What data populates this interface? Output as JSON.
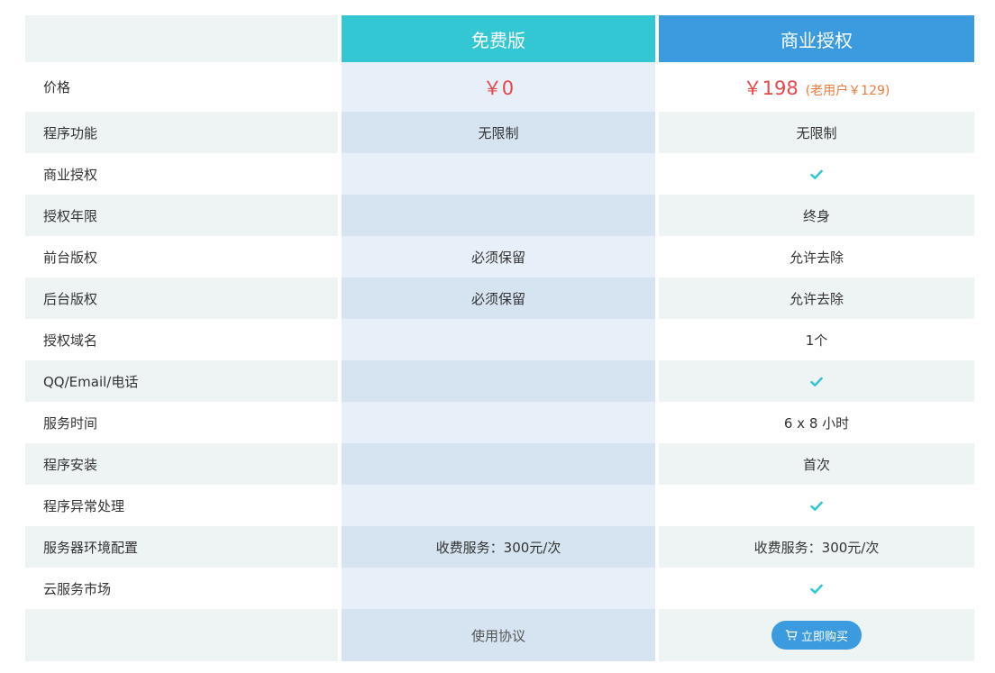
{
  "header": {
    "free": "免费版",
    "business": "商业授权"
  },
  "price": {
    "label": "价格",
    "free": "￥0",
    "business": "￥198",
    "business_old": "(老用户￥129)"
  },
  "rows": [
    {
      "label": "程序功能",
      "free": "无限制",
      "business": "无限制"
    },
    {
      "label": "商业授权",
      "free": "",
      "business": "check-icon"
    },
    {
      "label": "授权年限",
      "free": "",
      "business": "终身"
    },
    {
      "label": "前台版权",
      "free": "必须保留",
      "business": "允许去除"
    },
    {
      "label": "后台版权",
      "free": "必须保留",
      "business": "允许去除"
    },
    {
      "label": "授权域名",
      "free": "",
      "business": "1个"
    },
    {
      "label": "QQ/Email/电话",
      "free": "",
      "business": "check-icon"
    },
    {
      "label": "服务时间",
      "free": "",
      "business": "6 x 8 小时"
    },
    {
      "label": "程序安装",
      "free": "",
      "business": "首次"
    },
    {
      "label": "程序异常处理",
      "free": "",
      "business": "check-icon"
    },
    {
      "label": "服务器环境配置",
      "free": "收费服务：300元/次",
      "business": "收费服务：300元/次"
    },
    {
      "label": "云服务市场",
      "free": "",
      "business": "check-icon"
    }
  ],
  "footer": {
    "agreement_link": "使用协议",
    "buy_button": "立即购买",
    "buy_icon": "cart-icon"
  },
  "colors": {
    "free_header": "#33c6d3",
    "business_header": "#3b9bde",
    "price_red": "#e5474b",
    "old_price_orange": "#ed7a3b",
    "check_teal": "#33c6d3",
    "button_blue": "#3b9bde"
  }
}
